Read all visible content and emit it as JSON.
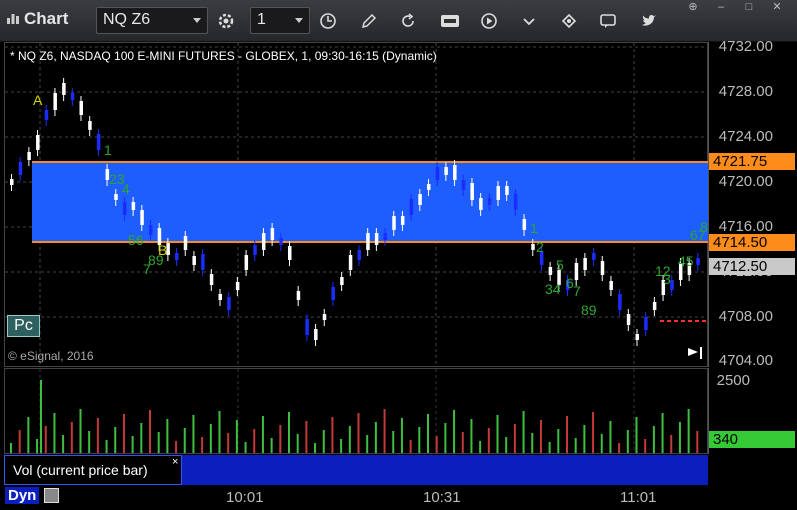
{
  "app": {
    "title": "Chart"
  },
  "toolbar": {
    "symbol": "NQ Z6",
    "interval": "1",
    "buttons": [
      "settings-icon",
      "clock-icon",
      "pencil-icon",
      "refresh-icon",
      "get-icon",
      "play-icon",
      "tools-icon",
      "comment-icon",
      "twitter-icon"
    ]
  },
  "window_controls": {
    "pin": "⊕",
    "minimize": "–",
    "maximize": "□",
    "close": "✕"
  },
  "caption": "* NQ Z6, NASDAQ 100 E-MINI FUTURES - GLOBEX, 1, 09:30-16:15 (Dynamic)",
  "copyright": "© eSignal, 2016",
  "pc_button": "Pc",
  "price_axis": {
    "ticks": [
      "4732.00",
      "4728.00",
      "4724.00",
      "4720.00",
      "4716.00",
      "4712.00",
      "4708.00",
      "4704.00"
    ],
    "tags": [
      {
        "label": "4721.75",
        "kind": "orange"
      },
      {
        "label": "4714.50",
        "kind": "orange"
      },
      {
        "label": "4712.50",
        "kind": "gray"
      }
    ]
  },
  "volume_axis": {
    "ticks": [
      "2500"
    ],
    "tag": "340"
  },
  "volume_legend": {
    "label": "Vol (current price bar)",
    "close": "×"
  },
  "time_axis": {
    "labels": [
      "10:01",
      "10:31",
      "11:01"
    ]
  },
  "status": {
    "mode": "Dyn"
  },
  "annotations": {
    "marker_a": "A",
    "marker_b": "B",
    "sequence_labels": [
      "1",
      "23",
      "4",
      "56",
      "7",
      "89",
      "1",
      "2",
      "5",
      "34",
      "6",
      "7",
      "89",
      "12",
      "3",
      "45",
      "67",
      "8"
    ]
  },
  "colors": {
    "range_fill": "#1e5eff",
    "range_line": "#ff8c1a",
    "up_candle": "#ffffff",
    "down_candle": "#1a2cff",
    "volume_up": "#3fbf3f",
    "volume_down": "#c43a3a",
    "label_green": "#2fa52f",
    "label_yellow": "#d4d400"
  }
}
